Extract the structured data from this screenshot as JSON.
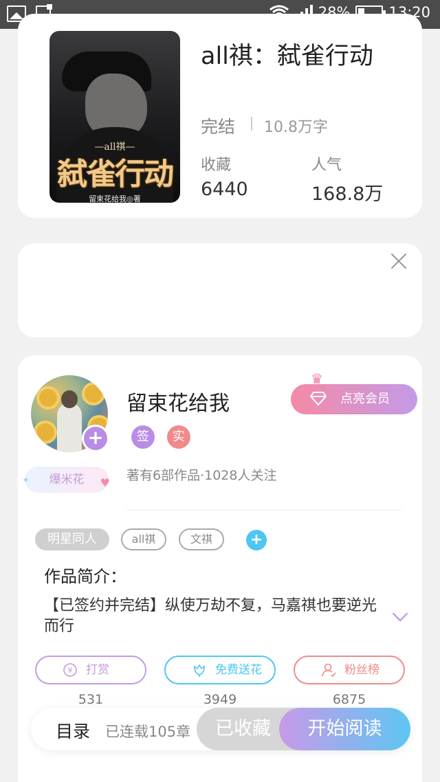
{
  "status_bar": {
    "wifi_icon": "wifi-icon",
    "signal_icon": "signal-icon",
    "battery_percent": "28%",
    "battery_level": 0.28,
    "time": "13:20"
  },
  "book": {
    "cover": {
      "subtitle": "—all祺—",
      "title": "弑雀行动",
      "author_line": "留束花给我◎著"
    },
    "title": "all祺：弑雀行动",
    "status": "完结",
    "word_count": "10.8万字",
    "stats": [
      {
        "label": "收藏",
        "value": "6440"
      },
      {
        "label": "人气",
        "value": "168.8万"
      }
    ]
  },
  "author": {
    "name": "留束花给我",
    "badges": [
      {
        "text": "签",
        "color": "#b98ce6"
      },
      {
        "text": "实",
        "color": "#f08a8a"
      }
    ],
    "popcorn_badge": "爆米花",
    "meta": "著有6部作品·1028人关注",
    "vip_button": "点亮会员"
  },
  "tags": {
    "primary": "明星同人",
    "secondary": [
      "all祺",
      "文祺"
    ]
  },
  "intro": {
    "title": "作品简介：",
    "text": "【已签约并完结】纵使万劫不复，马嘉祺也要逆光而行"
  },
  "actions": [
    {
      "label": "打赏",
      "count": "531",
      "color": "#c49ae0",
      "icon": "yen-icon"
    },
    {
      "label": "免费送花",
      "count": "3949",
      "color": "#4cc6f2",
      "icon": "flower-icon"
    },
    {
      "label": "粉丝榜",
      "count": "6875",
      "color": "#f08a8a",
      "icon": "person-icon"
    }
  ],
  "bottom_bar": {
    "toc": "目录",
    "chapters": "已连载105章",
    "favorited": "已收藏",
    "read": "开始阅读"
  },
  "colors": {
    "accent_purple": "#b98ce6",
    "accent_blue": "#4cc6f2",
    "accent_pink": "#f08a8a"
  }
}
